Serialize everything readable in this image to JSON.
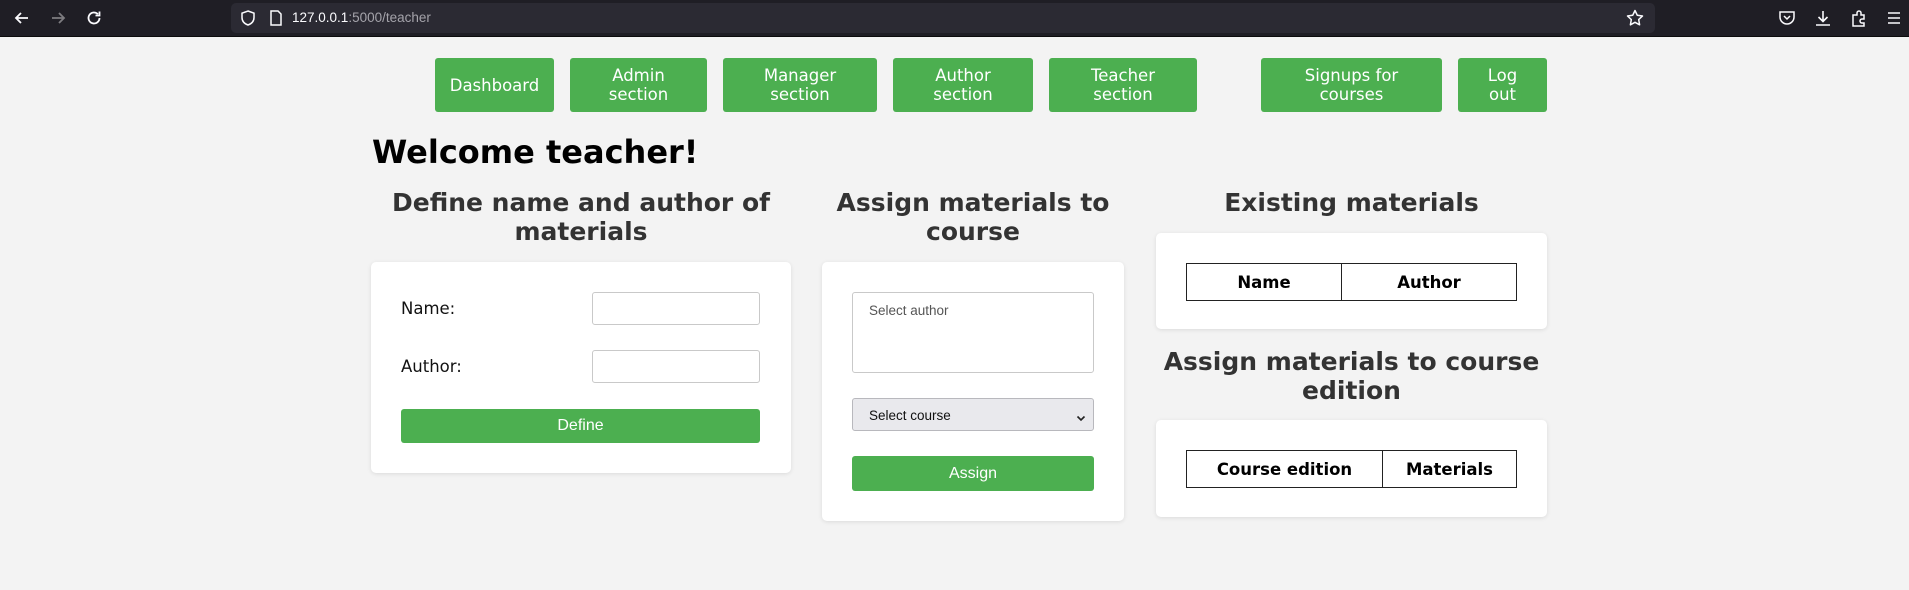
{
  "browser": {
    "url_host": "127.0.0.1",
    "url_rest": ":5000/teacher",
    "icons": [
      "back-arrow-icon",
      "forward-arrow-icon",
      "reload-icon",
      "shield-icon",
      "page-icon",
      "star-icon",
      "pocket-icon",
      "download-icon",
      "extensions-icon",
      "menu-icon"
    ]
  },
  "nav": {
    "dashboard": "Dashboard",
    "admin_1": "Admin",
    "admin_2": "section",
    "manager_1": "Manager",
    "manager_2": "section",
    "author_1": "Author",
    "author_2": "section",
    "teacher_1": "Teacher",
    "teacher_2": "section",
    "signups_1": "Signups for",
    "signups_2": "courses",
    "logout_1": "Log",
    "logout_2": "out"
  },
  "page": {
    "welcome": "Welcome teacher!"
  },
  "define": {
    "title_1": "Define name and author of",
    "title_2": "materials",
    "name_label": "Name:",
    "name_value": "",
    "author_label": "Author:",
    "author_value": "",
    "button": "Define"
  },
  "assign": {
    "title_1": "Assign materials to",
    "title_2": "course",
    "author_placeholder": "Select author",
    "course_selected": "Select course",
    "button": "Assign"
  },
  "existing": {
    "title": "Existing materials",
    "columns": [
      "Name",
      "Author"
    ]
  },
  "edition": {
    "title_1": "Assign materials to course",
    "title_2": "edition",
    "columns": [
      "Course edition",
      "Materials"
    ]
  },
  "colors": {
    "accent": "#4caf50",
    "background": "#f3f3f3",
    "chrome": "#1f1e25"
  }
}
